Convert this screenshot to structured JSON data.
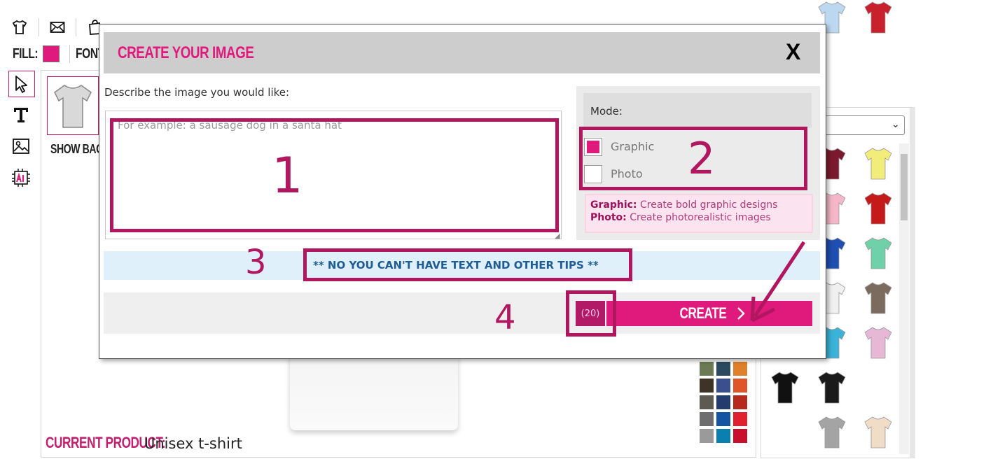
{
  "toolbar": {
    "fill_label": "FILL:",
    "font_label": "FONT",
    "fill_color": "#e0197d",
    "icons": [
      "tshirt-icon",
      "envelope-icon",
      "shopping-bag-icon"
    ]
  },
  "side_tools": [
    "pointer-icon",
    "text-tool-icon",
    "image-tool-icon",
    "ai-tool-icon"
  ],
  "canvas": {
    "show_back_label": "SHOW BACK",
    "current_product_label": "CURRENT PRODUCT:",
    "current_product_value": "Unisex t-shirt"
  },
  "swatch_colors": [
    "#6b7a55",
    "#2b4a5f",
    "#e0802c",
    "#3d3427",
    "#3b4f8f",
    "#e0542a",
    "#5c5a52",
    "#243b6e",
    "#b52a1c",
    "#6e6e6e",
    "#1554a3",
    "#e0202f",
    "#9a9a9a",
    "#0b7fb0",
    "#c8102e"
  ],
  "product_colors": [
    "#7b1a2e",
    "#f2ec7a",
    "#f4b6c8",
    "#c41a1a",
    "#1f4fb0",
    "#6fd1a8",
    "#f0f0f0",
    "#7a6b5e",
    "#3bb3d8",
    "#e7b8d6",
    "#111111",
    "#1a1a1a",
    "#a4a4a4",
    "#f1dcc6",
    "#bcd8f0",
    "#c8202c"
  ],
  "modal": {
    "title": "CREATE YOUR IMAGE",
    "close_label": "X",
    "describe_label": "Describe the image you would like:",
    "prompt_placeholder": "For example: a sausage dog in a santa hat",
    "mode_label": "Mode:",
    "modes": [
      {
        "label": "Graphic",
        "selected": true
      },
      {
        "label": "Photo",
        "selected": false
      }
    ],
    "hints": [
      {
        "term": "Graphic:",
        "text": "Create bold graphic designs"
      },
      {
        "term": "Photo:",
        "text": "Create photorealistic images"
      }
    ],
    "tips_text": "** NO YOU CAN'T HAVE TEXT AND OTHER TIPS **",
    "credits": "(20)",
    "create_label": "CREATE"
  },
  "annotations": [
    "1",
    "2",
    "3",
    "4"
  ]
}
